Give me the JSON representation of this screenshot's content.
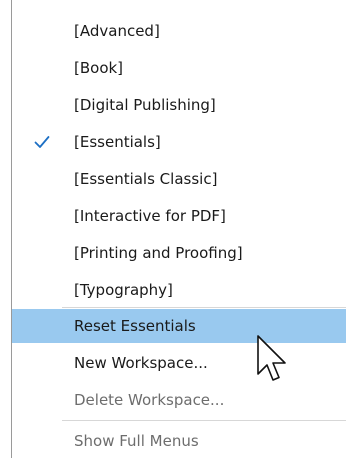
{
  "menu": {
    "workspaces": [
      {
        "label": "[Advanced]",
        "checked": false
      },
      {
        "label": "[Book]",
        "checked": false
      },
      {
        "label": "[Digital Publishing]",
        "checked": false
      },
      {
        "label": "[Essentials]",
        "checked": true
      },
      {
        "label": "[Essentials Classic]",
        "checked": false
      },
      {
        "label": "[Interactive for PDF]",
        "checked": false
      },
      {
        "label": "[Printing and Proofing]",
        "checked": false
      },
      {
        "label": "[Typography]",
        "checked": false
      }
    ],
    "actions": [
      {
        "label": "Reset Essentials",
        "highlighted": true,
        "enabled": true
      },
      {
        "label": "New Workspace...",
        "highlighted": false,
        "enabled": true
      },
      {
        "label": "Delete Workspace...",
        "highlighted": false,
        "enabled": false
      }
    ],
    "footer": {
      "show_full_menus_label": "Show Full Menus"
    }
  },
  "colors": {
    "highlight": "#99c9ef",
    "check": "#1c6fc4",
    "disabled_text": "#6d6d6d",
    "separator": "#d7d7d7"
  },
  "icons": {
    "check": "check-icon",
    "cursor": "mouse-pointer-icon"
  }
}
